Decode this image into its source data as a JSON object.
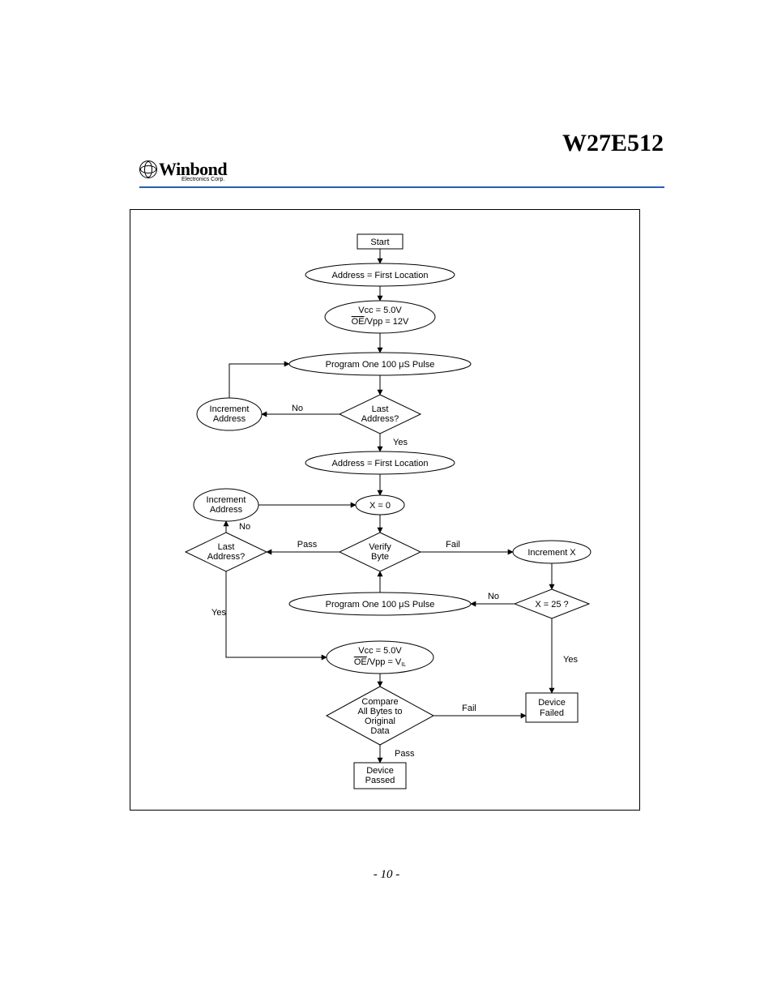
{
  "header": {
    "part_number": "W27E512",
    "logo_name": "Winbond",
    "logo_sub": "Electronics Corp."
  },
  "footer": {
    "page": "- 10 -"
  },
  "chart_data": {
    "type": "flowchart",
    "nodes": [
      {
        "id": "start",
        "shape": "rect",
        "text": "Start"
      },
      {
        "id": "addr_first_1",
        "shape": "ellipse",
        "text": "Address = First Location"
      },
      {
        "id": "vcc5_vpp12",
        "shape": "ellipse",
        "text": "Vcc = 5.0V\n‎OE/Vpp = 12V",
        "note": "OE has overline"
      },
      {
        "id": "prog_pulse_1",
        "shape": "ellipse",
        "text": "Program One 100 μS Pulse"
      },
      {
        "id": "incr_addr_1",
        "shape": "ellipse",
        "text": "Increment\nAddress"
      },
      {
        "id": "last_addr_1",
        "shape": "diamond",
        "text": "Last\nAddress?"
      },
      {
        "id": "addr_first_2",
        "shape": "ellipse",
        "text": "Address = First Location"
      },
      {
        "id": "incr_addr_2",
        "shape": "ellipse",
        "text": "Increment\nAddress"
      },
      {
        "id": "x_zero",
        "shape": "ellipse",
        "text": "X = 0"
      },
      {
        "id": "last_addr_2",
        "shape": "diamond",
        "text": "Last\nAddress?"
      },
      {
        "id": "verify_byte",
        "shape": "diamond",
        "text": "Verify\nByte"
      },
      {
        "id": "incr_x",
        "shape": "ellipse",
        "text": "Increment X"
      },
      {
        "id": "prog_pulse_2",
        "shape": "ellipse",
        "text": "Program One 100 μS Pulse"
      },
      {
        "id": "x_25",
        "shape": "diamond",
        "text": "X = 25 ?"
      },
      {
        "id": "vcc5_vppvil",
        "shape": "ellipse",
        "text": "Vcc = 5.0V\n‎OE/Vpp = VIL",
        "note": "OE has overline; IL subscript"
      },
      {
        "id": "compare_all",
        "shape": "diamond",
        "text": "Compare\nAll Bytes to\nOriginal\nData"
      },
      {
        "id": "dev_passed",
        "shape": "rect",
        "text": "Device\nPassed"
      },
      {
        "id": "dev_failed",
        "shape": "rect",
        "text": "Device\nFailed"
      }
    ],
    "edges": [
      {
        "from": "start",
        "to": "addr_first_1"
      },
      {
        "from": "addr_first_1",
        "to": "vcc5_vpp12"
      },
      {
        "from": "vcc5_vpp12",
        "to": "prog_pulse_1"
      },
      {
        "from": "prog_pulse_1",
        "to": "last_addr_1"
      },
      {
        "from": "last_addr_1",
        "to": "incr_addr_1",
        "label": "No"
      },
      {
        "from": "incr_addr_1",
        "to": "prog_pulse_1"
      },
      {
        "from": "last_addr_1",
        "to": "addr_first_2",
        "label": "Yes"
      },
      {
        "from": "addr_first_2",
        "to": "x_zero"
      },
      {
        "from": "x_zero",
        "to": "verify_byte"
      },
      {
        "from": "verify_byte",
        "to": "last_addr_2",
        "label": "Pass"
      },
      {
        "from": "last_addr_2",
        "to": "incr_addr_2",
        "label": "No"
      },
      {
        "from": "incr_addr_2",
        "to": "x_zero"
      },
      {
        "from": "verify_byte",
        "to": "incr_x",
        "label": "Fail"
      },
      {
        "from": "incr_x",
        "to": "x_25"
      },
      {
        "from": "x_25",
        "to": "prog_pulse_2",
        "label": "No"
      },
      {
        "from": "prog_pulse_2",
        "to": "verify_byte"
      },
      {
        "from": "x_25",
        "to": "dev_failed",
        "label": "Yes"
      },
      {
        "from": "last_addr_2",
        "to": "vcc5_vppvil",
        "label": "Yes"
      },
      {
        "from": "vcc5_vppvil",
        "to": "compare_all"
      },
      {
        "from": "compare_all",
        "to": "dev_passed",
        "label": "Pass"
      },
      {
        "from": "compare_all",
        "to": "dev_failed",
        "label": "Fail"
      }
    ]
  },
  "labels": {
    "yes": "Yes",
    "no": "No",
    "pass": "Pass",
    "fail": "Fail"
  }
}
